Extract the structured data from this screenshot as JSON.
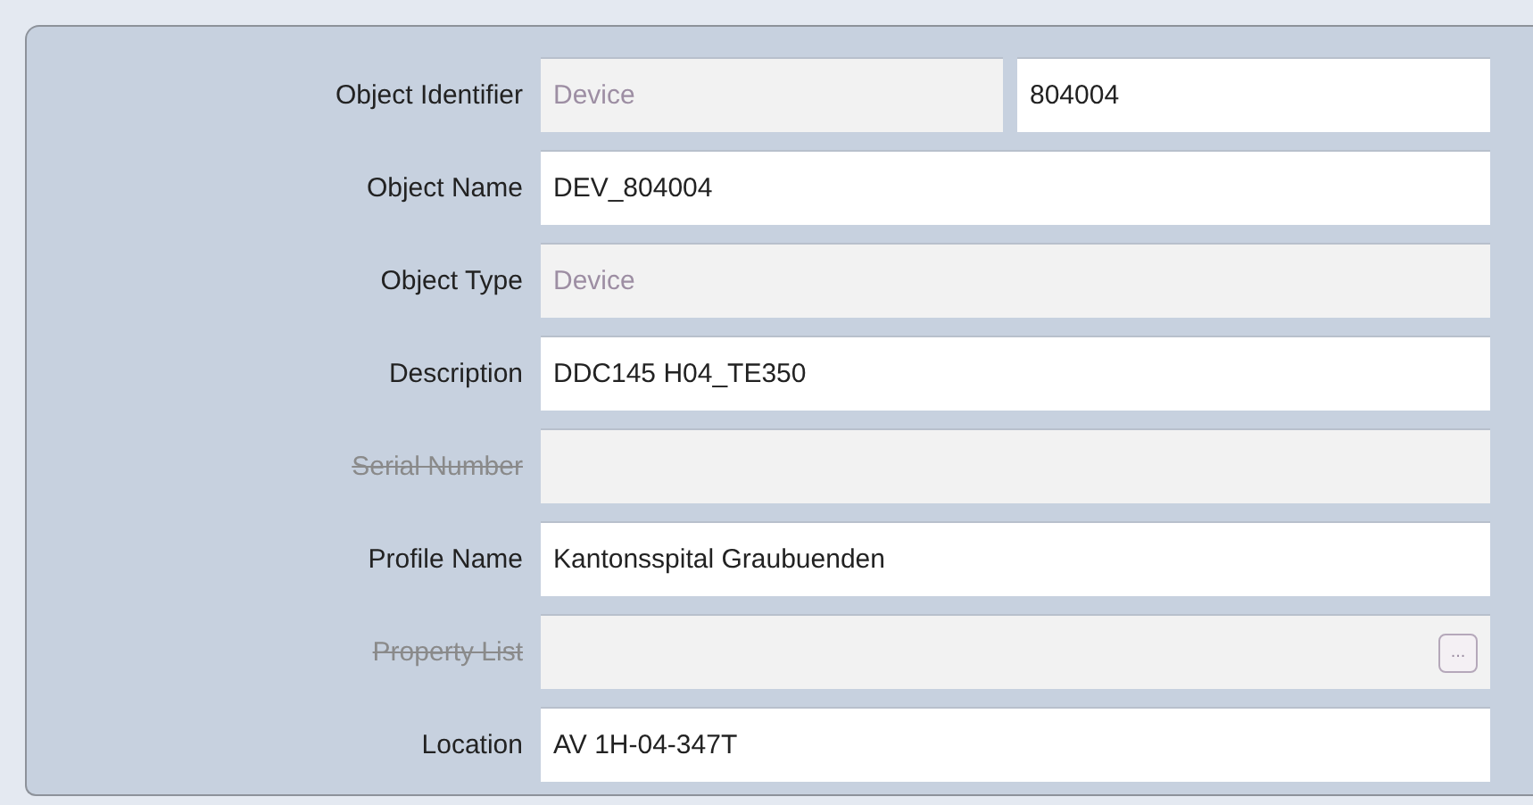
{
  "rows": [
    {
      "label": "Object Identifier",
      "disabled": false,
      "fields": [
        {
          "value": "Device",
          "disabled": true
        },
        {
          "value": "804004",
          "disabled": false
        }
      ]
    },
    {
      "label": "Object Name",
      "disabled": false,
      "fields": [
        {
          "value": "DEV_804004",
          "disabled": false
        }
      ]
    },
    {
      "label": "Object Type",
      "disabled": false,
      "fields": [
        {
          "value": "Device",
          "disabled": true
        }
      ]
    },
    {
      "label": "Description",
      "disabled": false,
      "fields": [
        {
          "value": "DDC145 H04_TE350",
          "disabled": false
        }
      ]
    },
    {
      "label": "Serial Number",
      "disabled": true,
      "fields": [
        {
          "disabled": true
        }
      ]
    },
    {
      "label": "Profile Name",
      "disabled": false,
      "fields": [
        {
          "value": "Kantonsspital Graubuenden",
          "disabled": false
        }
      ]
    },
    {
      "label": "Property List",
      "disabled": true,
      "fields": [
        {
          "disabled": true,
          "button": "..."
        }
      ]
    },
    {
      "label": "Location",
      "disabled": false,
      "fields": [
        {
          "value": "AV 1H-04-347T",
          "disabled": false
        }
      ]
    }
  ]
}
